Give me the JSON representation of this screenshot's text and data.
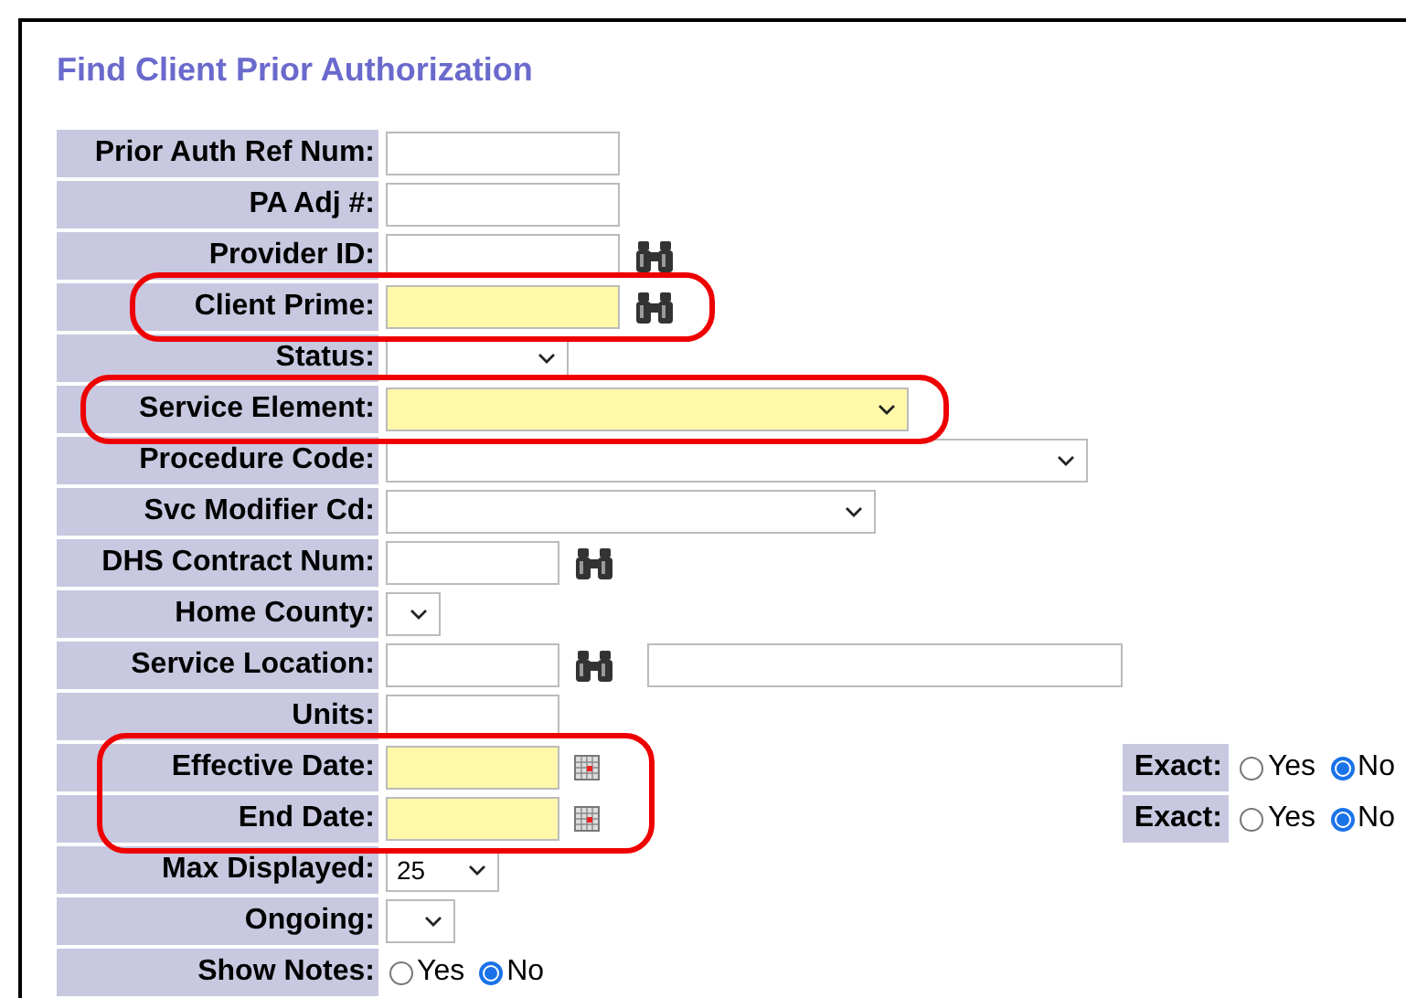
{
  "title": "Find Client Prior Authorization",
  "rows": [
    {
      "label": "Prior Auth Ref Num:",
      "kind": "text",
      "required": false,
      "annotated": false
    },
    {
      "label": "PA Adj #:",
      "kind": "text",
      "required": false,
      "annotated": false
    },
    {
      "label": "Provider ID:",
      "kind": "text",
      "required": false,
      "annotated": false,
      "lookup": true
    },
    {
      "label": "Client Prime:",
      "kind": "text",
      "required": true,
      "annotated": true,
      "lookup": true
    },
    {
      "label": "Status:",
      "kind": "select",
      "required": false,
      "annotated": false
    },
    {
      "label": "Service Element:",
      "kind": "select",
      "required": true,
      "annotated": true
    },
    {
      "label": "Procedure Code:",
      "kind": "select",
      "required": false,
      "annotated": false
    },
    {
      "label": "Svc Modifier Cd:",
      "kind": "select",
      "required": false,
      "annotated": false
    },
    {
      "label": "DHS Contract Num:",
      "kind": "text",
      "required": false,
      "annotated": false,
      "lookup": true
    },
    {
      "label": "Home County:",
      "kind": "select",
      "required": false,
      "annotated": false
    },
    {
      "label": "Service Location:",
      "kind": "text",
      "required": false,
      "annotated": false,
      "lookup": true,
      "second_field": true
    },
    {
      "label": "Units:",
      "kind": "text",
      "required": false,
      "annotated": false
    },
    {
      "label": "Effective Date:",
      "kind": "text",
      "required": true,
      "annotated": true,
      "calendar": true,
      "exact": {
        "label": "Exact:",
        "options": [
          {
            "label": "Yes",
            "selected": false
          },
          {
            "label": "No",
            "selected": true
          }
        ]
      }
    },
    {
      "label": "End Date:",
      "kind": "text",
      "required": true,
      "annotated": true,
      "calendar": true,
      "exact": {
        "label": "Exact:",
        "options": [
          {
            "label": "Yes",
            "selected": false
          },
          {
            "label": "No",
            "selected": true
          }
        ]
      }
    },
    {
      "label": "Max Displayed:",
      "kind": "select",
      "required": false,
      "annotated": false,
      "value": "25"
    },
    {
      "label": "Ongoing:",
      "kind": "select",
      "required": false,
      "annotated": false
    },
    {
      "label": "Show Notes:",
      "kind": "radio",
      "required": false,
      "annotated": false,
      "options": [
        {
          "label": "Yes",
          "selected": false
        },
        {
          "label": "No",
          "selected": true
        }
      ]
    }
  ]
}
